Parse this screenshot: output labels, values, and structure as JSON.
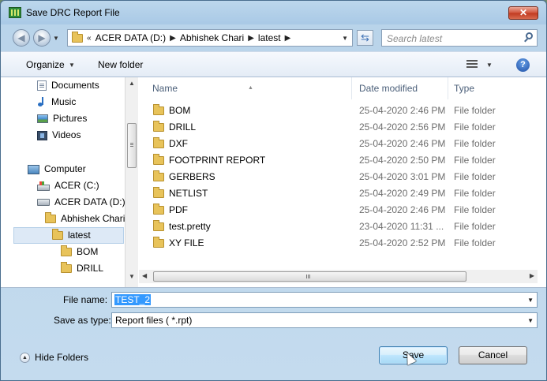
{
  "window": {
    "title": "Save DRC Report File",
    "close_label": "✕"
  },
  "navigation": {
    "back_label": "◀",
    "forward_label": "▶",
    "history_label": "▼",
    "breadcrumb_prefix": "«",
    "breadcrumbs": [
      "ACER DATA (D:)",
      "Abhishek Chari",
      "latest"
    ],
    "breadcrumb_separator": "▶",
    "address_dropdown": "▼",
    "refresh_label": "⇆",
    "search_placeholder": "Search latest"
  },
  "toolbar": {
    "organize_label": "Organize",
    "organize_arrow": "▼",
    "new_folder_label": "New folder",
    "views_arrow": "▼",
    "help_label": "?"
  },
  "sidebar": {
    "items": [
      {
        "label": "Documents",
        "icon": "documents-icon"
      },
      {
        "label": "Music",
        "icon": "music-icon"
      },
      {
        "label": "Pictures",
        "icon": "pictures-icon"
      },
      {
        "label": "Videos",
        "icon": "videos-icon"
      },
      {
        "label": "Computer",
        "icon": "computer-icon"
      },
      {
        "label": "ACER (C:)",
        "icon": "system-drive-icon"
      },
      {
        "label": "ACER DATA (D:)",
        "icon": "drive-icon"
      },
      {
        "label": "Abhishek Chari",
        "icon": "folder-icon"
      },
      {
        "label": "latest",
        "icon": "folder-icon",
        "selected": true
      },
      {
        "label": "BOM",
        "icon": "folder-icon"
      },
      {
        "label": "DRILL",
        "icon": "folder-icon"
      }
    ],
    "scroll_up": "▲",
    "scroll_down": "▼"
  },
  "file_list": {
    "columns": [
      "Name",
      "Date modified",
      "Type"
    ],
    "sort_caret": "▲",
    "rows": [
      {
        "name": "BOM",
        "date": "25-04-2020 2:46 PM",
        "type": "File folder"
      },
      {
        "name": "DRILL",
        "date": "25-04-2020 2:56 PM",
        "type": "File folder"
      },
      {
        "name": "DXF",
        "date": "25-04-2020 2:46 PM",
        "type": "File folder"
      },
      {
        "name": "FOOTPRINT REPORT",
        "date": "25-04-2020 2:50 PM",
        "type": "File folder"
      },
      {
        "name": "GERBERS",
        "date": "25-04-2020 3:01 PM",
        "type": "File folder"
      },
      {
        "name": "NETLIST",
        "date": "25-04-2020 2:49 PM",
        "type": "File folder"
      },
      {
        "name": "PDF",
        "date": "25-04-2020 2:46 PM",
        "type": "File folder"
      },
      {
        "name": "test.pretty",
        "date": "23-04-2020 11:31 ...",
        "type": "File folder"
      },
      {
        "name": "XY FILE",
        "date": "25-04-2020 2:52 PM",
        "type": "File folder"
      }
    ],
    "scroll_left": "◀",
    "scroll_right": "▶"
  },
  "form": {
    "file_name_label": "File name:",
    "file_name_value": "TEST_2",
    "save_as_type_label": "Save as type:",
    "save_as_type_value": "Report files ( *.rpt)",
    "dropdown_arrow": "▼"
  },
  "footer": {
    "hide_folders_label": "Hide Folders",
    "hide_arrow": "▲",
    "save_label": "Save",
    "cancel_label": "Cancel"
  }
}
